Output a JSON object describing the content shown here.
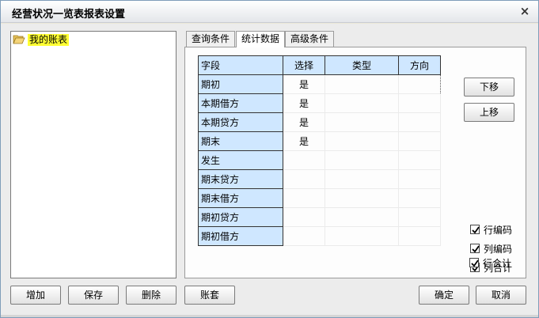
{
  "window": {
    "title": "经营状况一览表报表设置",
    "close_glyph": "×"
  },
  "tree": {
    "items": [
      {
        "label": "我的账表",
        "icon": "folder-open-icon"
      }
    ]
  },
  "tabs": [
    {
      "label": "查询条件",
      "active": false
    },
    {
      "label": "统计数据",
      "active": true
    },
    {
      "label": "高级条件",
      "active": false
    }
  ],
  "grid": {
    "headers": [
      "字段",
      "选择",
      "类型",
      "方向"
    ],
    "rows": [
      {
        "field": "期初",
        "select": "是",
        "type": "",
        "direction": ""
      },
      {
        "field": "本期借方",
        "select": "是",
        "type": "",
        "direction": ""
      },
      {
        "field": "本期贷方",
        "select": "是",
        "type": "",
        "direction": ""
      },
      {
        "field": "期末",
        "select": "是",
        "type": "",
        "direction": ""
      },
      {
        "field": "发生",
        "select": "",
        "type": "",
        "direction": ""
      },
      {
        "field": "期末贷方",
        "select": "",
        "type": "",
        "direction": ""
      },
      {
        "field": "期末借方",
        "select": "",
        "type": "",
        "direction": ""
      },
      {
        "field": "期初贷方",
        "select": "",
        "type": "",
        "direction": ""
      },
      {
        "field": "期初借方",
        "select": "",
        "type": "",
        "direction": ""
      }
    ]
  },
  "side_buttons": {
    "move_down": "下移",
    "move_up": "上移"
  },
  "checkboxes": [
    {
      "label": "行编码",
      "checked": true
    },
    {
      "label": "列编码",
      "checked": true
    },
    {
      "label": "列合计",
      "checked": true
    },
    {
      "label": "行合计",
      "checked": true
    }
  ],
  "footer": {
    "add": "增加",
    "save": "保存",
    "delete": "删除",
    "account_set": "账套",
    "ok": "确定",
    "cancel": "取消"
  },
  "colors": {
    "header_bg": "#cfe7ff",
    "highlight": "#ffff33",
    "window_bg": "#ececec"
  }
}
